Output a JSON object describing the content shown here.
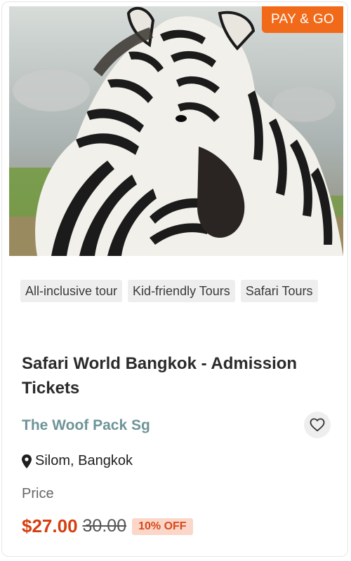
{
  "badge": {
    "label": "PAY & GO",
    "color": "#f16a1a"
  },
  "image": {
    "subject": "zebra",
    "icon": "zebra-photo"
  },
  "tags": [
    "All-inclusive tour",
    "Kid-friendly Tours",
    "Safari Tours"
  ],
  "listing": {
    "title": "Safari World Bangkok - Admission Tickets",
    "vendor": "The Woof Pack Sg",
    "location": "Silom, Bangkok",
    "location_icon": "map-pin-icon",
    "favorite_icon": "heart-icon"
  },
  "pricing": {
    "label": "Price",
    "price": "$27.00",
    "original_price": "30.00",
    "discount": "10% OFF",
    "accent_color": "#d43f10"
  }
}
